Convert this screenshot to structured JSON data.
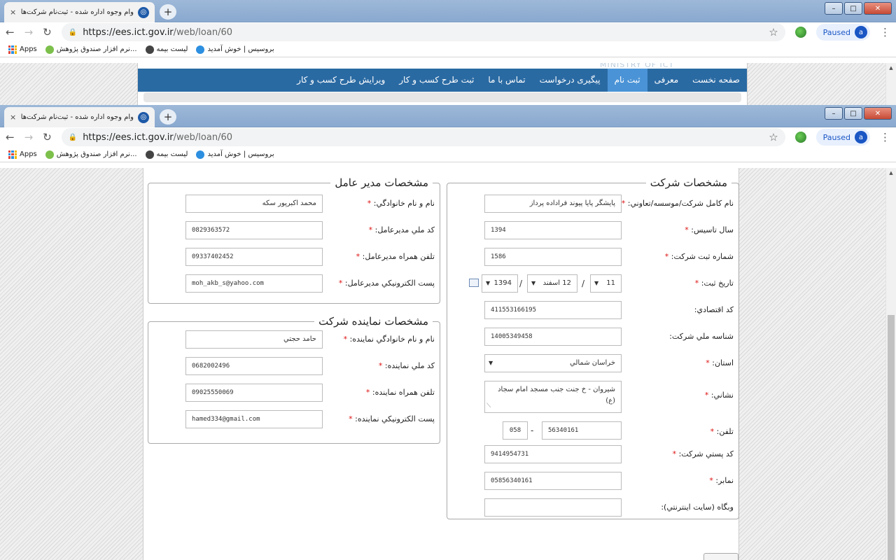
{
  "browser": {
    "tab_title": "وام وجوه اداره شده - ثبت‌نام شرکت‌های نوپا",
    "tab_close": "×",
    "new_tab": "+",
    "url_host": "https://ees.ict.gov.ir",
    "url_path": "/web/loan/60",
    "profile_status": "Paused",
    "profile_initial": "a",
    "bookmarks": [
      {
        "label": "Apps"
      },
      {
        "label": "نرم افزار صندوق پژوهش..."
      },
      {
        "label": "لیست بیمه"
      },
      {
        "label": "بروسیس | خوش آمدید"
      }
    ]
  },
  "site": {
    "nav_items": [
      "صفحه نخست",
      "معرفی",
      "ثبت نام",
      "پیگیری درخواست",
      "تماس با ما",
      "ثبت طرح کسب و کار",
      "ویرایش طرح کسب و کار"
    ],
    "active_index": 2,
    "ministry_banner": "MINISTRY OF ICT"
  },
  "form": {
    "company": {
      "legend": "مشخصات شرکت",
      "full_name_label": "نام کامل شرکت/موسسه/تعاوني:",
      "full_name": "پایشگر پایا پیوند فراداده پرداز",
      "founded_label": "سال تاسیس:",
      "founded": "1394",
      "reg_no_label": "شماره ثبت شرکت:",
      "reg_no": "1586",
      "reg_date_label": "تاریخ ثبت:",
      "reg_day": "11",
      "reg_month": "12 اسفند",
      "reg_year": "1394",
      "date_sep": "/",
      "econ_code_label": "کد اقتصادي:",
      "econ_code": "411553166195",
      "national_id_label": "شناسه ملي شرکت:",
      "national_id": "14005349458",
      "province_label": "استان:",
      "province": "خراسان شمالي",
      "address_label": "نشاني:",
      "address": "شیروان - خ جنت جنب مسجد امام سجاد (ع)",
      "phone_label": "تلفن:",
      "phone": "56340161",
      "phone_sep": "-",
      "phone_code": "058",
      "postal_label": "کد پستي شرکت:",
      "postal": "9414954731",
      "fax_label": "نمابر:",
      "fax": "05856340161",
      "website_label": "وبگاه (سایت اینترنتي):",
      "website": ""
    },
    "ceo": {
      "legend": "مشخصات مدير عامل",
      "name_label": "نام و نام خانوادگي:",
      "name": "محمد اکبرپور سکه",
      "nid_label": "کد ملي مديرعامل:",
      "nid": "0829363572",
      "mobile_label": "تلفن همراه مديرعامل:",
      "mobile": "09337402452",
      "email_label": "پست الکترونيکي مديرعامل:",
      "email": "moh_akb_s@yahoo.com"
    },
    "rep": {
      "legend": "مشخصات نماينده شركت",
      "name_label": "نام و نام خانوادگي نماينده:",
      "name": "حامد حجتي",
      "nid_label": "کد ملي نماينده:",
      "nid": "0682002496",
      "mobile_label": "تلفن همراه نماينده:",
      "mobile": "09025550069",
      "email_label": "پست الکترونيکي نماينده:",
      "email": "hamed334@gmail.com"
    },
    "required_mark": "*"
  }
}
